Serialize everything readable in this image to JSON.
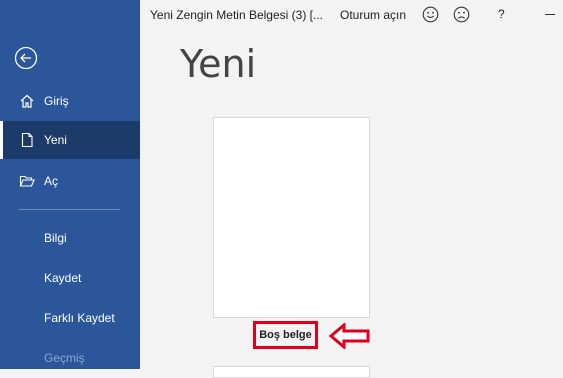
{
  "titlebar": {
    "doc_title": "Yeni Zengin Metin Belgesi (3) [...",
    "signin": "Oturum açın",
    "help": "?"
  },
  "sidebar": {
    "items": [
      {
        "label": "Giriş",
        "icon": "home-icon"
      },
      {
        "label": "Yeni",
        "icon": "new-document-icon",
        "active": true
      },
      {
        "label": "Aç",
        "icon": "open-folder-icon"
      }
    ],
    "sub_items": [
      {
        "label": "Bilgi"
      },
      {
        "label": "Kaydet"
      },
      {
        "label": "Farklı Kaydet"
      },
      {
        "label": "Geçmiş",
        "disabled": true
      }
    ]
  },
  "main": {
    "title": "Yeni",
    "templates": [
      {
        "label": "Boş belge"
      }
    ]
  },
  "colors": {
    "sidebar_bg": "#2b579a",
    "active_bg": "#1d3b6a",
    "highlight": "#e0001b"
  }
}
